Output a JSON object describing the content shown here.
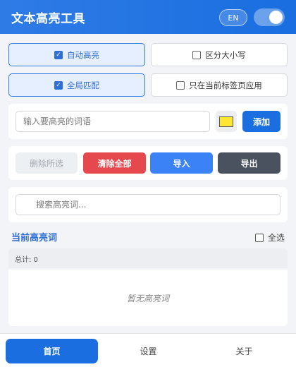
{
  "header": {
    "title": "文本高亮工具",
    "lang_label": "EN",
    "enabled": true
  },
  "options": [
    {
      "label": "自动高亮",
      "checked": true
    },
    {
      "label": "区分大小写",
      "checked": false
    },
    {
      "label": "全局匹配",
      "checked": true
    },
    {
      "label": "只在当前标签页应用",
      "checked": false
    }
  ],
  "add": {
    "placeholder": "输入要高亮的词语",
    "color": "#ffe633",
    "button_label": "添加"
  },
  "actions": {
    "delete_selected": "删除所选",
    "clear_all": "清除全部",
    "import": "导入",
    "export": "导出"
  },
  "search": {
    "placeholder": "搜索高亮词..."
  },
  "list": {
    "title": "当前高亮词",
    "select_all_label": "全选",
    "count_text": "总计: 0",
    "empty_text": "暂无高亮词"
  },
  "nav": {
    "home": "首页",
    "settings": "设置",
    "about": "关于",
    "active": "home"
  },
  "colors": {
    "primary": "#1a6ee0",
    "danger": "#e5484d",
    "accent": "#3b82f6",
    "dark": "#4a5260"
  }
}
